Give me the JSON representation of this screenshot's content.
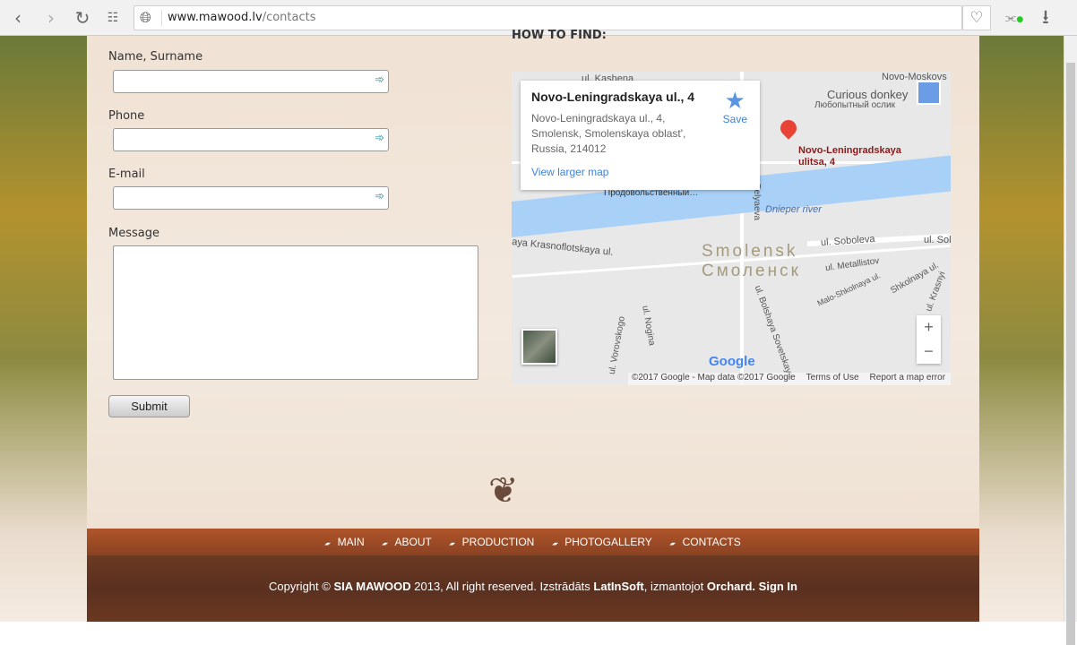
{
  "browser": {
    "url_host": "www.mawood.lv",
    "url_path": "/contacts",
    "icons": [
      "back-icon",
      "forward-icon",
      "reload-icon",
      "apps-grid-icon",
      "globe-icon",
      "heart-icon",
      "extension-icon",
      "download-icon"
    ]
  },
  "form": {
    "name_label": "Name, Surname",
    "phone_label": "Phone",
    "email_label": "E-mail",
    "message_label": "Message",
    "submit_label": "Submit",
    "name_value": "",
    "phone_value": "",
    "email_value": "",
    "message_value": ""
  },
  "map": {
    "heading": "HOW TO FIND:",
    "info_title": "Novo-Leningradskaya ul., 4",
    "info_address_1": "Novo-Leningradskaya ul., 4,",
    "info_address_2": "Smolensk, Smolenskaya oblast',",
    "info_address_3": "Russia, 214012",
    "save": "Save",
    "view_larger": "View larger map",
    "pin_label_1": "Novo-Leningradskaya",
    "pin_label_2": "ulitsa, 4",
    "labels": {
      "kashena": "ul. Kashena",
      "novo_moskov": "Novo-Moskovs",
      "donkey": "Curious donkey",
      "donkey_ru": "Любопытный ослик",
      "prod": "Продовольственный…",
      "dnieper": "Dnieper river",
      "krasno": "aya Krasnoflotskaya ul.",
      "soboleva": "ul. Soboleva",
      "soboleva2": "ul. Sol",
      "metallistov": "ul. Metallistov",
      "malo": "Malo-Shkolnaya ul.",
      "shkolnaya": "Shkolnaya ul.",
      "bolshaya": "ul. Bolshaya Sovetskaya",
      "vorovskogo": "ul. Vorovskogo",
      "nogina": "ul. Nogina",
      "belyaeva": "Belyaeva",
      "krasny": "ul. Krasnyi"
    },
    "city_en": "Smolensk",
    "city_ru": "Смоленск",
    "google": "Google",
    "attribution": "©2017 Google - Map data ©2017 Google",
    "terms": "Terms of Use",
    "report": "Report a map error",
    "zoom_in": "+",
    "zoom_out": "−"
  },
  "footer": {
    "nav": [
      "MAIN",
      "ABOUT",
      "PRODUCTION",
      "PHOTOGALLERY",
      "CONTACTS"
    ],
    "c1": "Copyright © ",
    "c2": "SIA MAWOOD",
    "c3": " 2013, All right reserved. Izstrādāts ",
    "c4": "LatInSoft",
    "c5": ", izmantojot ",
    "c6": "Orchard.",
    "c7": "Sign In"
  }
}
